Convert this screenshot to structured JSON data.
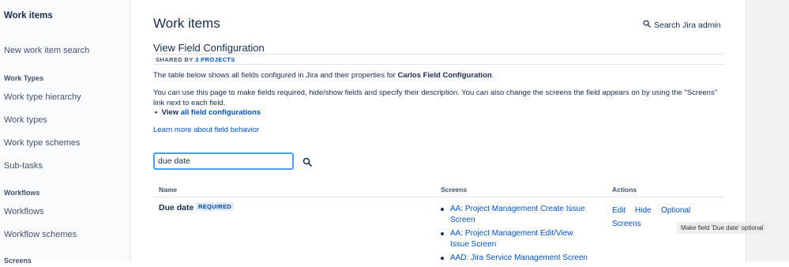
{
  "sidebar": {
    "title": "Work items",
    "items": [
      {
        "label": "New work item search"
      },
      {
        "section": "Work Types"
      },
      {
        "label": "Work type hierarchy"
      },
      {
        "label": "Work types"
      },
      {
        "label": "Work type schemes"
      },
      {
        "label": "Sub-tasks"
      },
      {
        "section": "Workflows"
      },
      {
        "label": "Workflows"
      },
      {
        "label": "Workflow schemes"
      },
      {
        "section": "Screens"
      }
    ]
  },
  "header": {
    "title": "Work items",
    "search_label": "Search Jira admin"
  },
  "config": {
    "heading": "View Field Configuration",
    "shared_prefix": "SHARED BY",
    "shared_count": "3 PROJECTS",
    "desc1_prefix": "The table below shows all fields configured in Jira and their properties for",
    "desc1_bold": "Carlos Field Configuration",
    "desc1_suffix": ".",
    "desc2": "You can use this page to make fields required, hide/show fields and specify their description. You can also change the screens the field appears on by using the \"Screens\" link next to each field.",
    "view_prefix": "View",
    "view_link": "all field configurations",
    "learn_more": "Learn more about field behavior"
  },
  "search": {
    "value": "due date"
  },
  "table": {
    "headers": {
      "name": "Name",
      "screens": "Screens",
      "actions": "Actions"
    },
    "rows": [
      {
        "name": "Due date",
        "badge": "REQUIRED",
        "screens": [
          "AA: Project Management Create Issue Screen",
          "AA: Project Management Edit/View Issue Screen",
          "AAD: Jira Service Management Screen"
        ],
        "actions": {
          "edit": "Edit",
          "hide": "Hide",
          "optional": "Optional",
          "screens": "Screens"
        }
      }
    ]
  },
  "tooltip": {
    "text": "Make field 'Due date' optional"
  }
}
